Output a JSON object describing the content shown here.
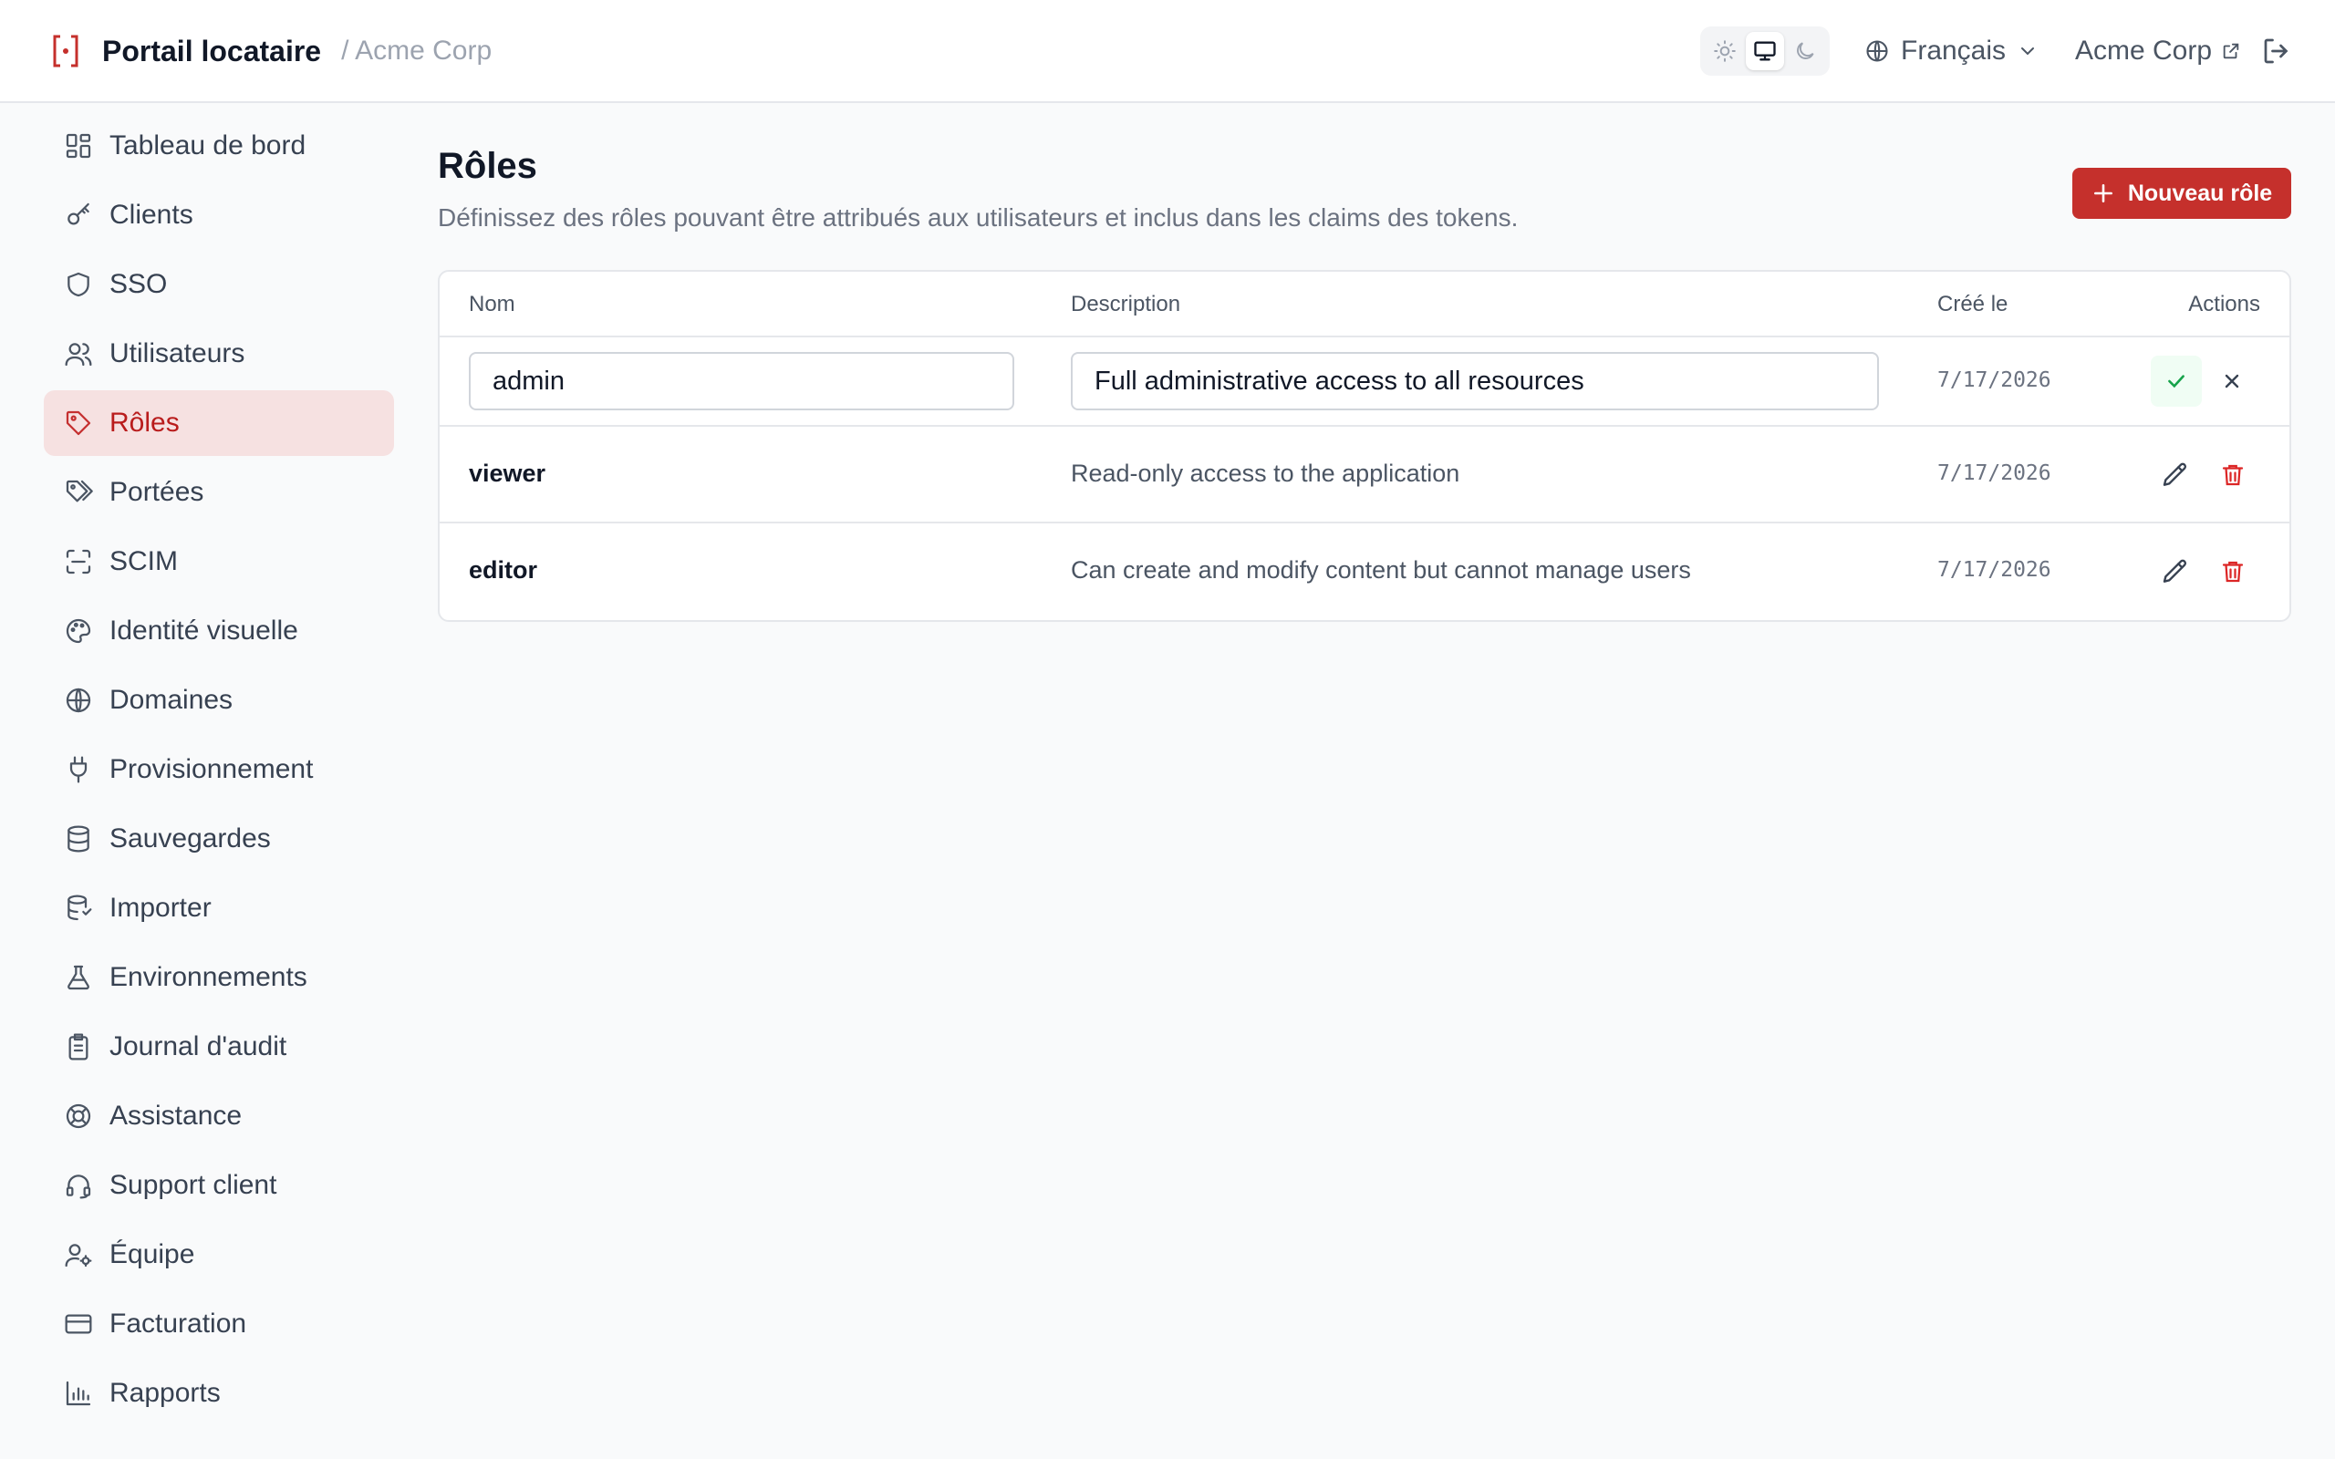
{
  "header": {
    "app_title": "Portail locataire",
    "breadcrumb": "/ Acme Corp",
    "theme_options": [
      "light",
      "system",
      "dark"
    ],
    "theme_selected": "system",
    "language": "Français",
    "organization": "Acme Corp"
  },
  "sidebar": {
    "items": [
      {
        "label": "Tableau de bord",
        "icon": "dashboard-icon"
      },
      {
        "label": "Clients",
        "icon": "key-icon"
      },
      {
        "label": "SSO",
        "icon": "shield-icon"
      },
      {
        "label": "Utilisateurs",
        "icon": "users-icon"
      },
      {
        "label": "Rôles",
        "icon": "tag-icon"
      },
      {
        "label": "Portées",
        "icon": "tags-icon"
      },
      {
        "label": "SCIM",
        "icon": "scan-icon"
      },
      {
        "label": "Identité visuelle",
        "icon": "palette-icon"
      },
      {
        "label": "Domaines",
        "icon": "globe-icon"
      },
      {
        "label": "Provisionnement",
        "icon": "plug-icon"
      },
      {
        "label": "Sauvegardes",
        "icon": "database-icon"
      },
      {
        "label": "Importer",
        "icon": "database-import-icon"
      },
      {
        "label": "Environnements",
        "icon": "flask-icon"
      },
      {
        "label": "Journal d'audit",
        "icon": "clipboard-icon"
      },
      {
        "label": "Assistance",
        "icon": "lifebuoy-icon"
      },
      {
        "label": "Support client",
        "icon": "headset-icon"
      },
      {
        "label": "Équipe",
        "icon": "user-cog-icon"
      },
      {
        "label": "Facturation",
        "icon": "credit-card-icon"
      },
      {
        "label": "Rapports",
        "icon": "bar-chart-icon"
      }
    ],
    "active_index": 4
  },
  "main": {
    "title": "Rôles",
    "description": "Définissez des rôles pouvant être attribués aux utilisateurs et inclus dans les claims des tokens.",
    "new_button": "Nouveau rôle",
    "columns": {
      "name": "Nom",
      "description": "Description",
      "created": "Créé le",
      "actions": "Actions"
    },
    "rows": [
      {
        "name": "admin",
        "description": "Full administrative access to all resources",
        "created": "7/17/2026",
        "editing": true
      },
      {
        "name": "viewer",
        "description": "Read-only access to the application",
        "created": "7/17/2026",
        "editing": false
      },
      {
        "name": "editor",
        "description": "Can create and modify content but cannot manage users",
        "created": "7/17/2026",
        "editing": false
      }
    ]
  },
  "colors": {
    "accent": "#c5302c",
    "active_nav_bg": "#f6e1e1",
    "confirm_green": "#16a34a"
  }
}
